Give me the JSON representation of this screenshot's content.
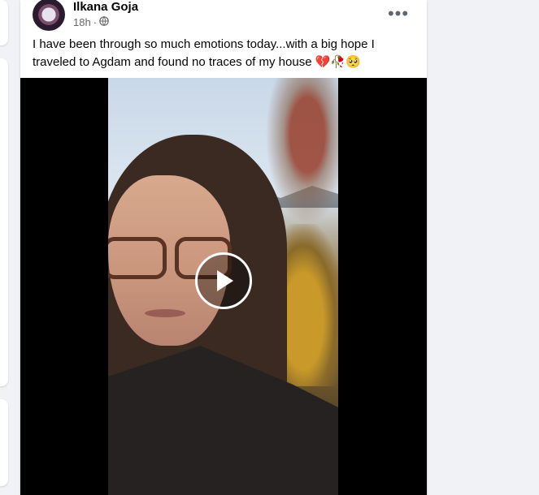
{
  "post": {
    "author": "Ilkana Goja",
    "time": "18h",
    "separator": "·",
    "audience_icon": "globe-icon",
    "more_icon": "more-options-icon",
    "more_label": "•••",
    "text": "I have been through so much emotions today...with a big hope I traveled to Agdam and found no traces of my house 💔🥀🥺"
  },
  "video": {
    "play_icon": "play-icon"
  },
  "colors": {
    "background": "#f0f2f5",
    "card": "#ffffff",
    "text": "#050505",
    "secondary_text": "#65676b"
  }
}
